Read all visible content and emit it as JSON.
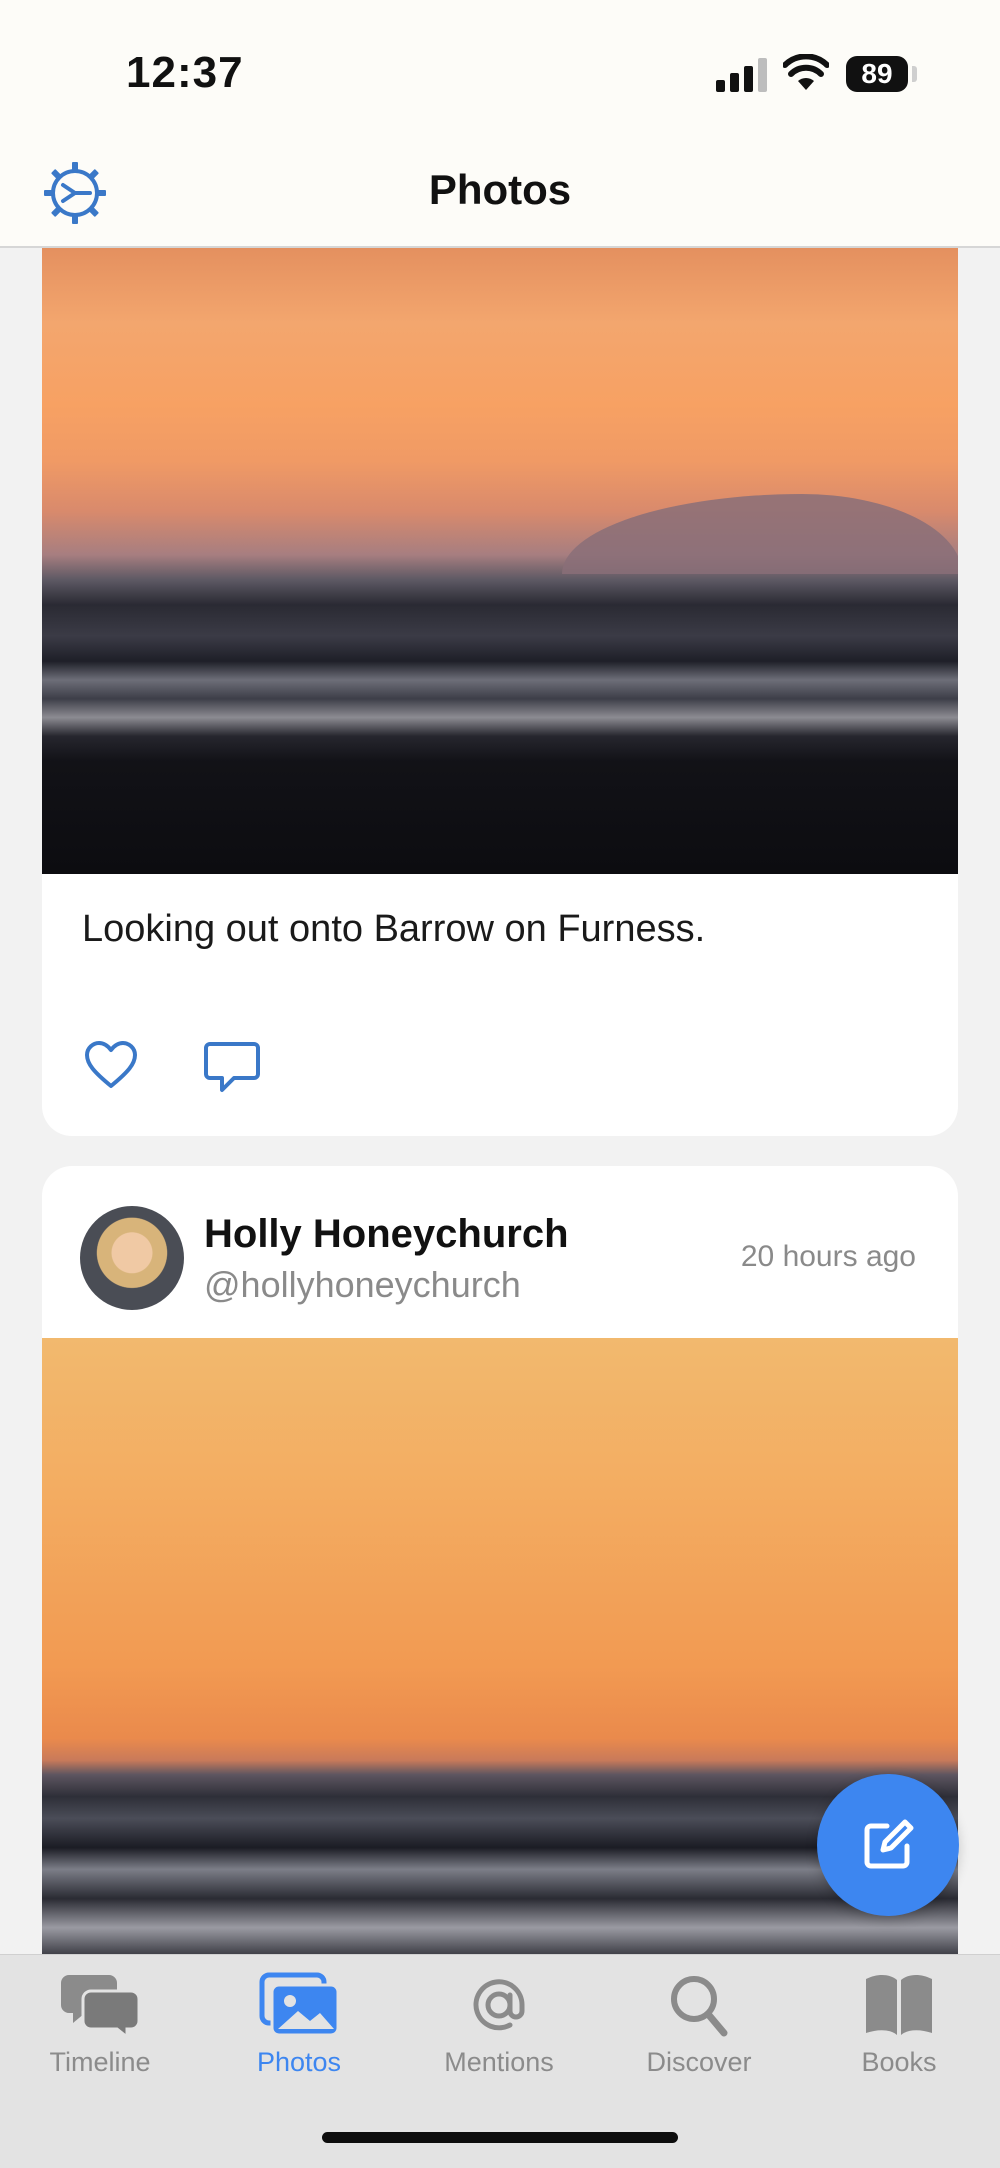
{
  "status_bar": {
    "time": "12:37",
    "battery": "89"
  },
  "nav": {
    "title": "Photos",
    "settings_icon": "gear-icon"
  },
  "posts": [
    {
      "caption": "Looking out onto Barrow on Furness.",
      "actions": [
        "heart-icon",
        "comment-icon"
      ]
    },
    {
      "author_name": "Holly Honeychurch",
      "author_handle": "@hollyhoneychurch",
      "timestamp": "20 hours ago"
    }
  ],
  "fab": {
    "icon": "compose-icon"
  },
  "tabs": [
    {
      "label": "Timeline",
      "icon": "timeline-icon",
      "active": false
    },
    {
      "label": "Photos",
      "icon": "photos-icon",
      "active": true
    },
    {
      "label": "Mentions",
      "icon": "at-icon",
      "active": false
    },
    {
      "label": "Discover",
      "icon": "search-icon",
      "active": false
    },
    {
      "label": "Books",
      "icon": "book-icon",
      "active": false
    }
  ],
  "colors": {
    "accent": "#3d86f0",
    "tab_inactive": "#8b8b8b",
    "icon_blue": "#3a78c8"
  }
}
